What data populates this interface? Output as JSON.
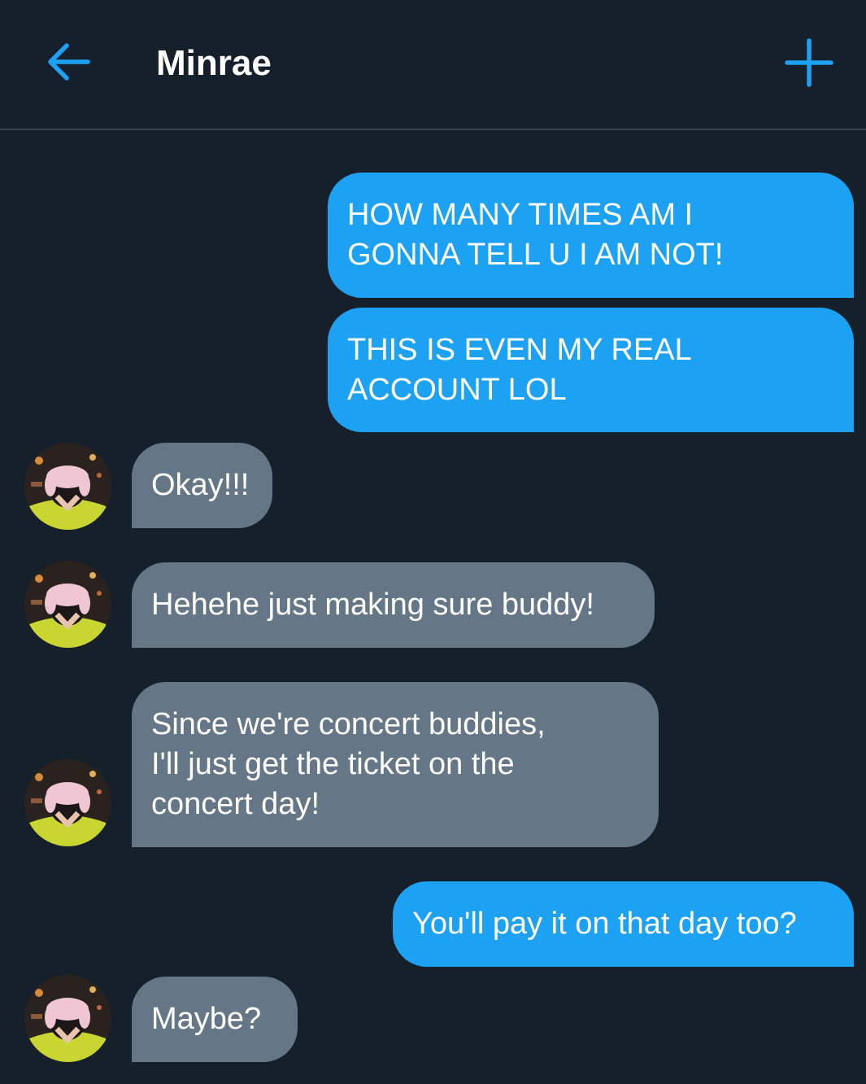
{
  "header": {
    "back_icon": "arrow-left-icon",
    "title": "Minrae",
    "plus_icon": "plus-icon"
  },
  "colors": {
    "background": "#15202b",
    "accent": "#1da1f2",
    "received_bubble": "#657786",
    "divider": "#38444d",
    "text": "#ffffff"
  },
  "messages": [
    {
      "direction": "sent",
      "text": "HOW MANY TIMES AM I\nGONNA TELL U I AM NOT!"
    },
    {
      "direction": "sent",
      "text": "THIS IS EVEN MY REAL\nACCOUNT LOL"
    },
    {
      "direction": "received",
      "text": "Okay!!!"
    },
    {
      "direction": "received",
      "text": "Hehehe just making sure buddy!"
    },
    {
      "direction": "received",
      "text": "Since we're concert buddies,\nI'll just get the ticket on the\nconcert day!"
    },
    {
      "direction": "sent",
      "text": "You'll pay it on that day too?"
    },
    {
      "direction": "received",
      "text": "Maybe?"
    }
  ]
}
